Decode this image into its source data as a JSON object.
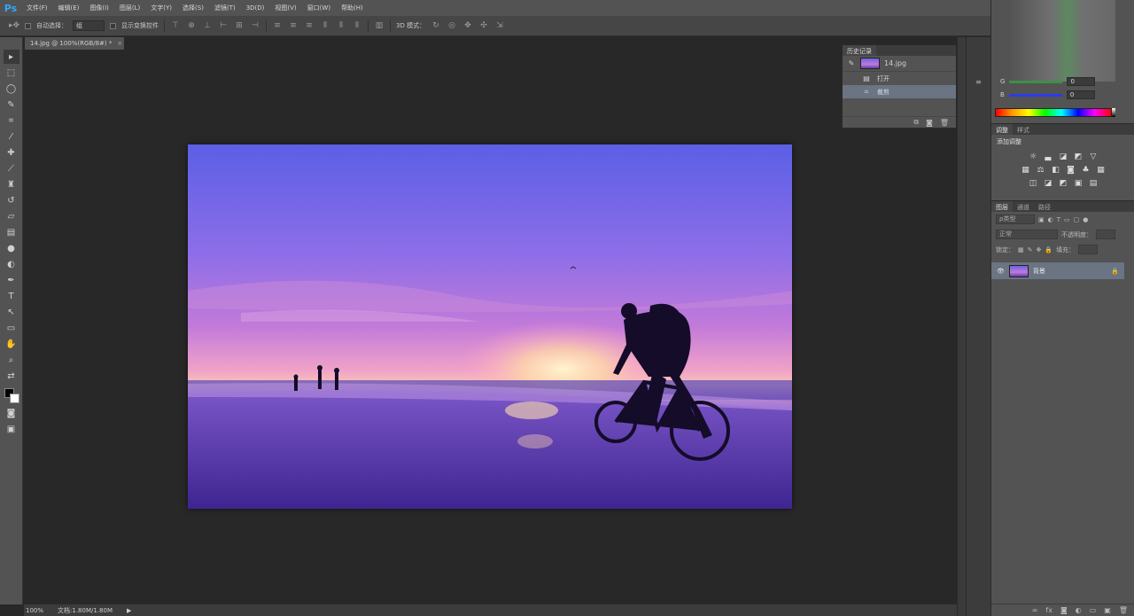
{
  "app": {
    "logo": "Ps"
  },
  "menu": [
    "文件(F)",
    "编辑(E)",
    "图像(I)",
    "图层(L)",
    "文字(Y)",
    "选择(S)",
    "滤镜(T)",
    "3D(D)",
    "视图(V)",
    "窗口(W)",
    "帮助(H)"
  ],
  "options": {
    "auto_select_label": "自动选择：",
    "auto_select_value": "组",
    "transform_controls_label": "显示变换控件",
    "mode3d_label": "3D 模式："
  },
  "document": {
    "tab_title": "14.jpg @ 100%(RGB/8#) *",
    "close_glyph": "×"
  },
  "statusbar": {
    "zoom": "100%",
    "doc_info": "文档:1.80M/1.80M"
  },
  "history": {
    "tab_label": "历史记录",
    "snapshot_name": "14.jpg",
    "steps": [
      {
        "label": "打开",
        "icon": "document-icon",
        "selected": false
      },
      {
        "label": "裁剪",
        "icon": "crop-icon",
        "selected": true
      }
    ]
  },
  "color": {
    "channels": [
      {
        "name": "G",
        "value": "0",
        "color": "#4caf50"
      },
      {
        "name": "B",
        "value": "0",
        "color": "#3344ff"
      }
    ]
  },
  "adjustments": {
    "tabs": [
      "调整",
      "样式"
    ],
    "title": "添加调整"
  },
  "layers": {
    "tabs": [
      "图层",
      "通道",
      "路径"
    ],
    "filter_label": "ρ类型",
    "blend_mode": "正常",
    "opacity_label": "不透明度：",
    "lock_label": "锁定：",
    "fill_label": "填充：",
    "items": [
      {
        "name": "背景",
        "locked": true,
        "visible": true
      }
    ]
  }
}
